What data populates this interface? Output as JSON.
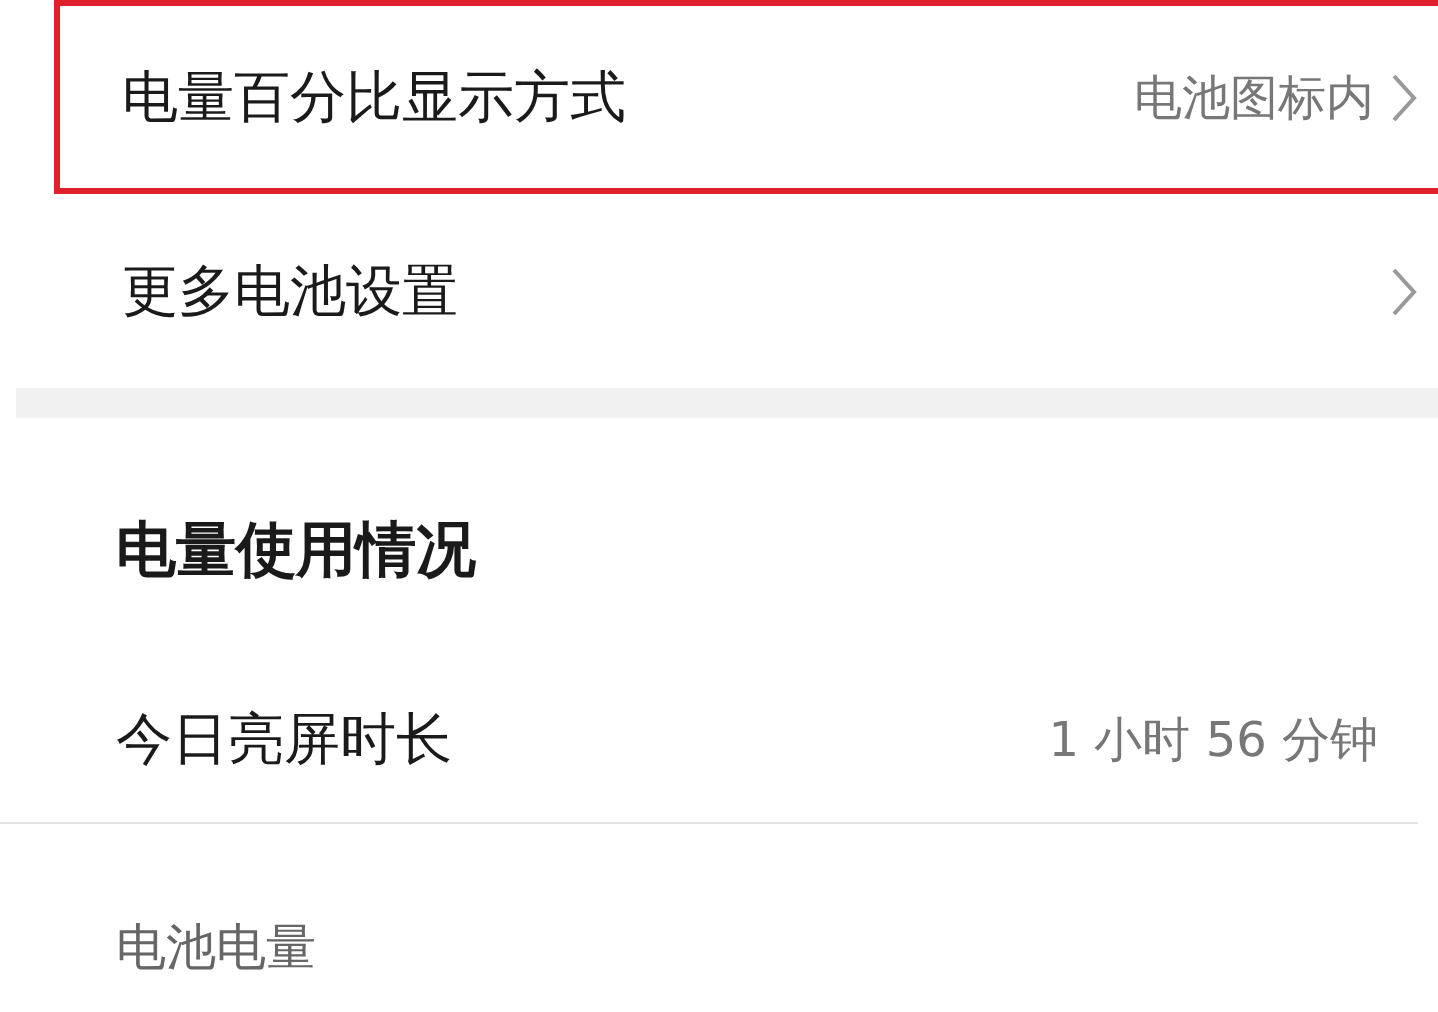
{
  "settings_rows": [
    {
      "label": "电量百分比显示方式",
      "value": "电池图标内",
      "highlighted": true
    },
    {
      "label": "更多电池设置",
      "highlighted": false
    }
  ],
  "usage_section": {
    "title": "电量使用情况",
    "rows": [
      {
        "label": "今日亮屏时长",
        "value": "1 小时 56 分钟"
      }
    ],
    "subheading": "电池电量"
  }
}
